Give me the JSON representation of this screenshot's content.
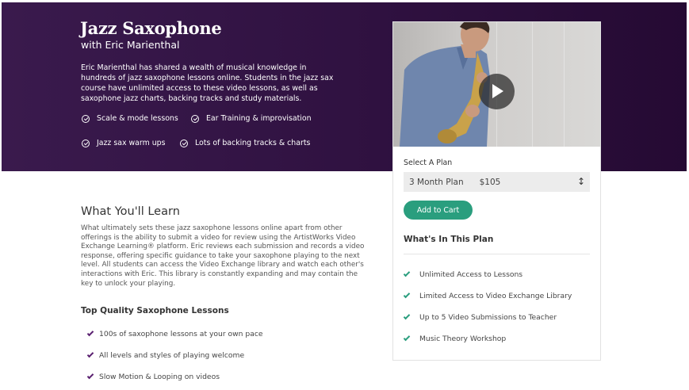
{
  "colors": {
    "hero_bg": "#2f1140",
    "accent_green": "#2a9e7e",
    "check_purple": "#5a2070"
  },
  "hero": {
    "title": "Jazz Saxophone",
    "subtitle": "with Eric Marienthal",
    "description": "Eric Marienthal has shared a wealth of musical knowledge in hundreds of jazz saxophone lessons online. Students in the jazz sax course have unlimited access to these video lessons, as well as saxophone jazz charts, backing tracks and study materials.",
    "features": [
      {
        "label": "Scale & mode lessons",
        "icon": "check-circle-icon"
      },
      {
        "label": "Ear Training & improvisation",
        "icon": "check-circle-icon"
      },
      {
        "label": "Jazz sax warm ups",
        "icon": "check-circle-icon"
      },
      {
        "label": "Lots of backing tracks & charts",
        "icon": "check-circle-icon"
      }
    ]
  },
  "plan_card": {
    "video_icon": "play-icon",
    "select_label": "Select A Plan",
    "selected_plan": "3 Month Plan",
    "selected_price": "$105",
    "select_arrows": "↕",
    "add_to_cart": "Add to Cart",
    "included_heading": "What's In This Plan",
    "included_items": [
      "Unlimited Access to Lessons",
      "Limited Access to Video Exchange Library",
      "Up to 5 Video Submissions to Teacher",
      "Music Theory Workshop"
    ]
  },
  "learn": {
    "title": "What You'll Learn",
    "body": "What ultimately sets these jazz saxophone lessons online apart from other offerings is the ability to submit a video for review using the ArtistWorks Video Exchange Learning® platform. Eric reviews each submission and records a video response, offering specific guidance to take your saxophone playing to the next level. All students can access the Video Exchange library and watch each other's interactions with Eric. This library is constantly expanding and may contain the key to unlock your playing."
  },
  "top_quality": {
    "title": "Top Quality Saxophone Lessons",
    "items": [
      "100s of saxophone lessons at your own pace",
      "All levels and styles of playing welcome",
      "Slow Motion & Looping on videos"
    ]
  }
}
